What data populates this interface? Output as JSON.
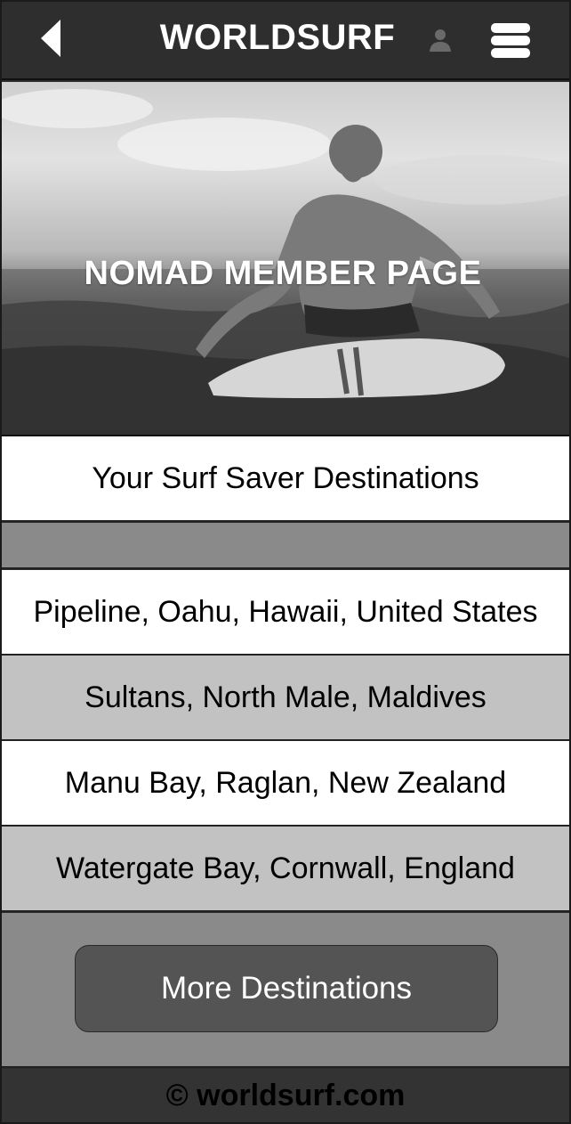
{
  "header": {
    "title": "WORLDSURF",
    "back_icon": "back-arrow-icon",
    "user_icon": "user-icon",
    "menu_icon": "hamburger-menu-icon"
  },
  "hero": {
    "title": "NOMAD MEMBER PAGE"
  },
  "section": {
    "heading": "Your Surf Saver Destinations"
  },
  "destinations": [
    "Pipeline, Oahu, Hawaii, United States",
    "Sultans, North Male, Maldives",
    "Manu Bay, Raglan, New Zealand",
    "Watergate Bay, Cornwall, England"
  ],
  "more_button": {
    "label": "More Destinations"
  },
  "footer": {
    "text": "© worldsurf.com"
  },
  "colors": {
    "header_bg": "#2e2e2e",
    "row_alt_bg": "#c2c2c2",
    "panel_bg": "#8a8a8a",
    "button_bg": "#545454"
  }
}
